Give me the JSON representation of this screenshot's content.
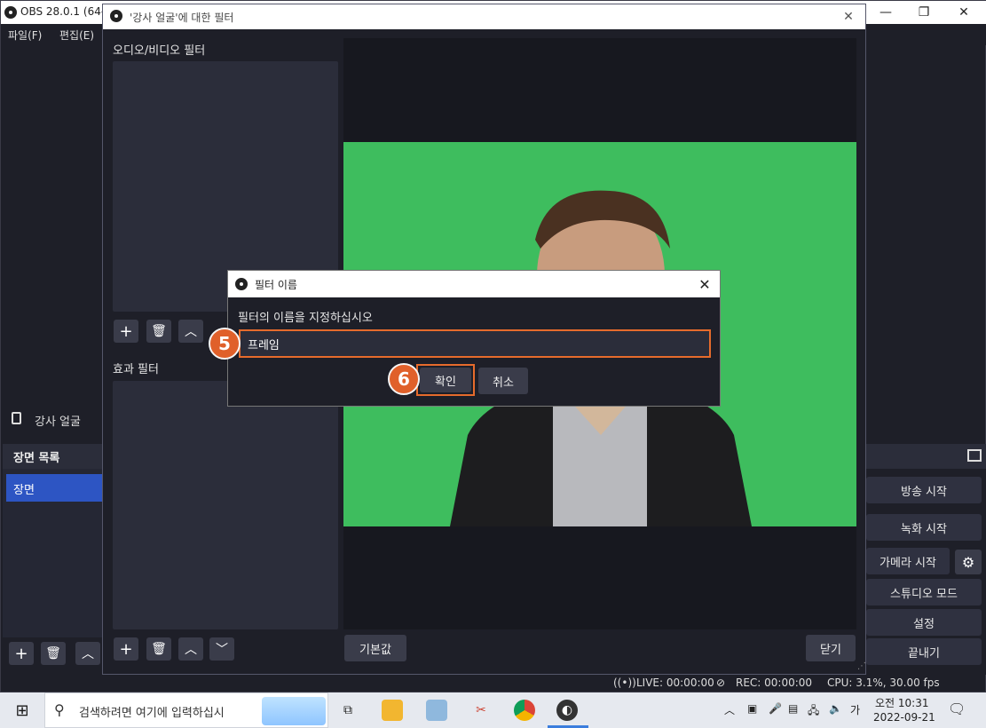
{
  "obs": {
    "title": "OBS 28.0.1 (64-",
    "menu": [
      "파일(F)",
      "편집(E)"
    ],
    "source_name": "강사 얼굴",
    "scenes_header": "장면 목록",
    "scene_item": "장면",
    "controls": [
      "방송 시작",
      "녹화 시작",
      "가메라 시작",
      "스튜디오 모드",
      "설정",
      "끝내기"
    ],
    "status": {
      "live": "LIVE: 00:00:00",
      "rec": "REC: 00:00:00",
      "cpu": "CPU: 3.1%, 30.00 fps"
    }
  },
  "filters_dialog": {
    "title": "'강사 얼굴'에 대한 필터",
    "av_filters_label": "오디오/비디오 필터",
    "effect_filters_label": "효과 필터",
    "defaults_button": "기본값",
    "close_button": "닫기"
  },
  "name_dialog": {
    "title": "필터 이름",
    "prompt": "필터의 이름을 지정하십시오",
    "input_value": "프레임",
    "ok_button": "확인",
    "cancel_button": "취소",
    "step_input": "5",
    "step_ok": "6"
  },
  "taskbar": {
    "search_placeholder": "검색하려면 여기에 입력하십시",
    "time": "오전 10:31",
    "date": "2022-09-21",
    "ime": "가"
  },
  "colors": {
    "accent_orange": "#e66b2c",
    "selection_blue": "#2d55c3",
    "chroma_green": "#3ebd5e"
  }
}
